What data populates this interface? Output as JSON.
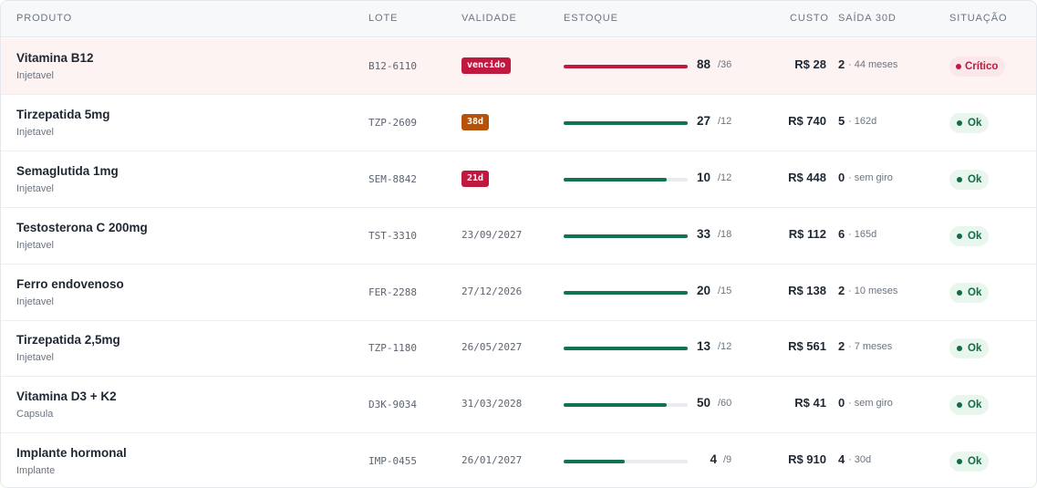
{
  "headers": {
    "produto": "PRODUTO",
    "lote": "LOTE",
    "validade": "VALIDADE",
    "estoque": "ESTOQUE",
    "custo": "CUSTO",
    "saida": "SAÍDA 30D",
    "situacao": "SITUAÇÃO"
  },
  "colors": {
    "bar_ok": "#127350",
    "bar_critical": "#c0193f",
    "badge_red": "#c0193f",
    "badge_orange": "#b45309"
  },
  "rows": [
    {
      "name": "Vitamina B12",
      "type": "Injetavel",
      "lote": "B12-6110",
      "validade": "vencido",
      "validade_style": "badge-red",
      "qty": "88",
      "max": "/36",
      "fill": 1.0,
      "bar": "critical",
      "custo": "R$ 28",
      "saida_n": "2",
      "saida_t": "· 44 meses",
      "status": "Crítico",
      "status_kind": "crit"
    },
    {
      "name": "Tirzepatida 5mg",
      "type": "Injetavel",
      "lote": "TZP-2609",
      "validade": "38d",
      "validade_style": "badge-orange",
      "qty": "27",
      "max": "/12",
      "fill": 1.0,
      "bar": "ok",
      "custo": "R$ 740",
      "saida_n": "5",
      "saida_t": "· 162d",
      "status": "Ok",
      "status_kind": "ok"
    },
    {
      "name": "Semaglutida 1mg",
      "type": "Injetavel",
      "lote": "SEM-8842",
      "validade": "21d",
      "validade_style": "badge-red",
      "qty": "10",
      "max": "/12",
      "fill": 0.83,
      "bar": "ok",
      "custo": "R$ 448",
      "saida_n": "0",
      "saida_t": "· sem giro",
      "status": "Ok",
      "status_kind": "ok"
    },
    {
      "name": "Testosterona C 200mg",
      "type": "Injetavel",
      "lote": "TST-3310",
      "validade": "23/09/2027",
      "validade_style": "text",
      "qty": "33",
      "max": "/18",
      "fill": 1.0,
      "bar": "ok",
      "custo": "R$ 112",
      "saida_n": "6",
      "saida_t": "· 165d",
      "status": "Ok",
      "status_kind": "ok"
    },
    {
      "name": "Ferro endovenoso",
      "type": "Injetavel",
      "lote": "FER-2288",
      "validade": "27/12/2026",
      "validade_style": "text",
      "qty": "20",
      "max": "/15",
      "fill": 1.0,
      "bar": "ok",
      "custo": "R$ 138",
      "saida_n": "2",
      "saida_t": "· 10 meses",
      "status": "Ok",
      "status_kind": "ok"
    },
    {
      "name": "Tirzepatida 2,5mg",
      "type": "Injetavel",
      "lote": "TZP-1180",
      "validade": "26/05/2027",
      "validade_style": "text",
      "qty": "13",
      "max": "/12",
      "fill": 1.0,
      "bar": "ok",
      "custo": "R$ 561",
      "saida_n": "2",
      "saida_t": "· 7 meses",
      "status": "Ok",
      "status_kind": "ok"
    },
    {
      "name": "Vitamina D3 + K2",
      "type": "Capsula",
      "lote": "D3K-9034",
      "validade": "31/03/2028",
      "validade_style": "text",
      "qty": "50",
      "max": "/60",
      "fill": 0.83,
      "bar": "ok",
      "custo": "R$ 41",
      "saida_n": "0",
      "saida_t": "· sem giro",
      "status": "Ok",
      "status_kind": "ok"
    },
    {
      "name": "Implante hormonal",
      "type": "Implante",
      "lote": "IMP-0455",
      "validade": "26/01/2027",
      "validade_style": "text",
      "qty": "4",
      "max": "/9",
      "fill": 0.49,
      "bar": "ok",
      "custo": "R$ 910",
      "saida_n": "4",
      "saida_t": "· 30d",
      "status": "Ok",
      "status_kind": "ok"
    }
  ]
}
